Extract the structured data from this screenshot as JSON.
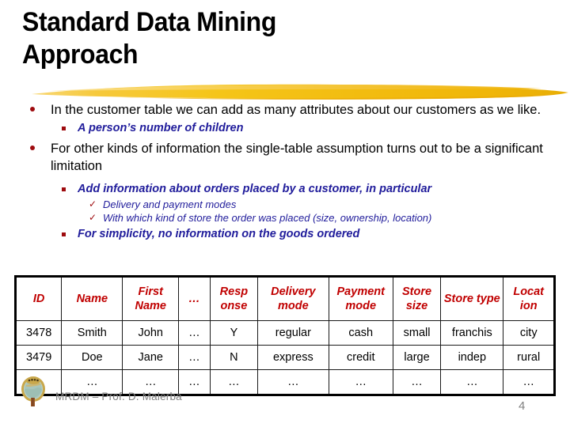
{
  "slide": {
    "title": "Standard Data Mining\nApproach",
    "accent_yellow": "#F5C518",
    "bullet_red": "#9E0B0F",
    "level2_blue": "#201C9B",
    "header_red": "#C00000",
    "footer_gray": "#808080"
  },
  "bullets": [
    {
      "level": 1,
      "text": "In the customer table we can add as many attributes about our customers as we like.",
      "marker": "round-bullet"
    },
    {
      "level": 2,
      "text": "A person’s number of children",
      "marker": "square-bullet"
    },
    {
      "level": 1,
      "text": "For other kinds of information the single-table assumption turns out to be a significant limitation",
      "marker": "round-bullet"
    },
    {
      "level": 2,
      "text": "Add information about orders placed by a customer, in particular",
      "marker": "square-bullet"
    },
    {
      "level": 3,
      "text": "Delivery and payment modes",
      "marker": "✓"
    },
    {
      "level": 3,
      "text": "With which kind of store the order was placed (size, ownership, location)",
      "marker": "✓"
    },
    {
      "level": 2,
      "text": "For simplicity, no information on the goods ordered",
      "marker": "square-bullet"
    }
  ],
  "table": {
    "headers": [
      "ID",
      "Name",
      "First Name",
      "…",
      "Resp onse",
      "Delivery mode",
      "Payment mode",
      "Store size",
      "Store type",
      "Locat ion"
    ],
    "rows": [
      [
        "3478",
        "Smith",
        "John",
        "…",
        "Y",
        "regular",
        "cash",
        "small",
        "franchis",
        "city"
      ],
      [
        "3479",
        "Doe",
        "Jane",
        "…",
        "N",
        "express",
        "credit",
        "large",
        "indep",
        "rural"
      ],
      [
        "…",
        "…",
        "…",
        "…",
        "…",
        "…",
        "…",
        "…",
        "…",
        "…"
      ]
    ]
  },
  "footer": {
    "text": "MRDM – Prof. D. Malerba",
    "page_number": "4",
    "logo": "university-seal-logo"
  }
}
